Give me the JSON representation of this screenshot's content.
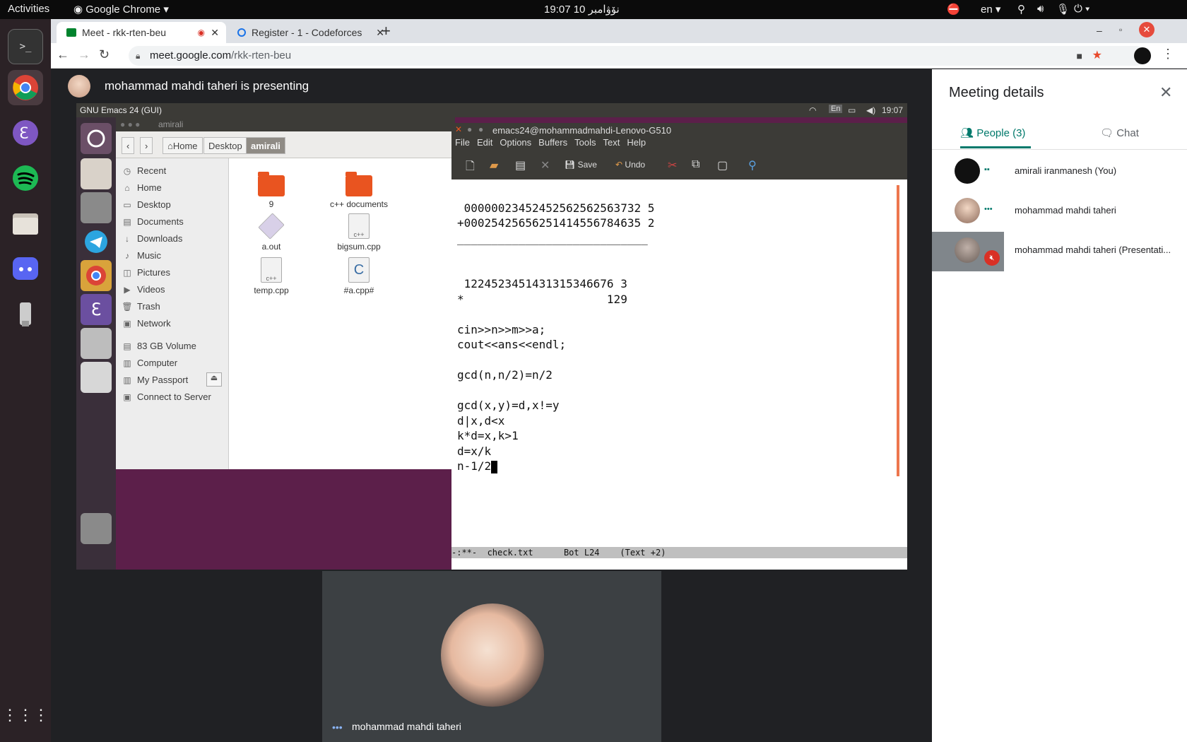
{
  "topbar": {
    "activities": "Activities",
    "app": "Google Chrome",
    "clock": "19:07 10 نۆۋامبر",
    "lang": "en"
  },
  "chrome": {
    "tabs": [
      {
        "label": "Meet - rkk-rten-beu"
      },
      {
        "label": "Register - 1 - Codeforces"
      }
    ],
    "url_host": "meet.google.com",
    "url_path": "/rkk-rten-beu"
  },
  "meet": {
    "presenting": "mohammad mahdi taheri is presenting",
    "self_tile_name": "mohammad mahdi taheri"
  },
  "screen": {
    "topbar_title": "GNU Emacs 24 (GUI)",
    "topbar_time": "19:07",
    "topbar_lang": "En",
    "nautilus": {
      "title": "amirali",
      "crumbs": [
        "Home",
        "Desktop",
        "amirali"
      ],
      "sidebar": [
        "Recent",
        "Home",
        "Desktop",
        "Documents",
        "Downloads",
        "Music",
        "Pictures",
        "Videos",
        "Trash",
        "Network",
        "83 GB Volume",
        "Computer",
        "My Passport",
        "Connect to Server"
      ],
      "files": [
        "9",
        "c++ documents",
        "a.out",
        "bigsum.cpp",
        "temp.cpp",
        "#a.cpp#"
      ]
    },
    "emacs": {
      "title": "emacs24@mohammadmahdi-Lenovo-G510",
      "menu": [
        "File",
        "Edit",
        "Options",
        "Buffers",
        "Tools",
        "Text",
        "Help"
      ],
      "save_label": "Save",
      "undo_label": "Undo",
      "lines": [
        "",
        " 00000023452452562562563732 5",
        "+00025425656251414556784635 2",
        "____________________________",
        "",
        "",
        " 1224523451431315346676 3",
        "*                     129",
        "",
        "cin>>n>>m>>a;",
        "cout<<ans<<endl;",
        "",
        "gcd(n,n/2)=n/2",
        "",
        "gcd(x,y)=d,x!=y",
        "d|x,d<x",
        "k*d=x,k>1",
        "d=x/k",
        "n-1/2"
      ],
      "modeline": "-:**-  check.txt      Bot L24    (Text +2)"
    }
  },
  "details": {
    "title": "Meeting details",
    "people_tab": "People (3)",
    "chat_tab": "Chat",
    "participants": [
      {
        "name": "amirali iranmanesh (You)"
      },
      {
        "name": "mohammad mahdi taheri"
      },
      {
        "name": "mohammad mahdi taheri (Presentati..."
      }
    ]
  }
}
